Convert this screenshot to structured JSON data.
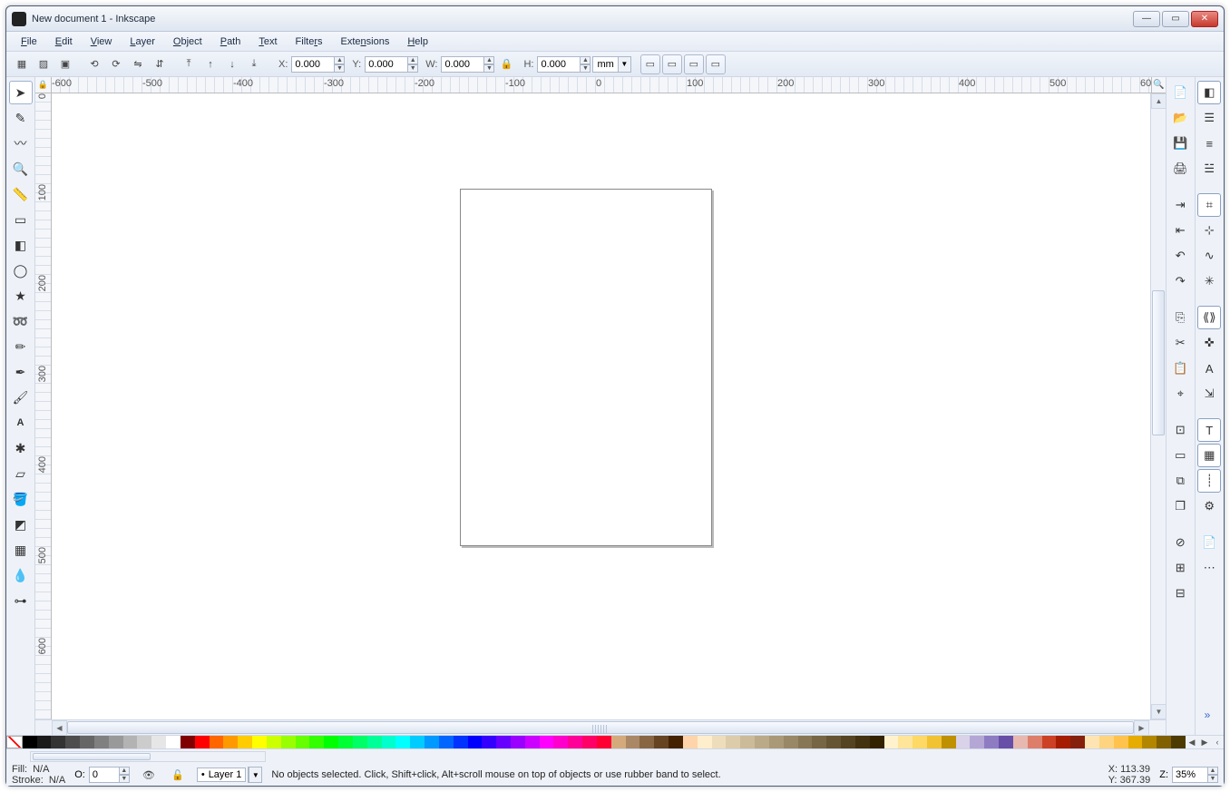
{
  "window": {
    "title": "New document 1 - Inkscape"
  },
  "menu": [
    "File",
    "Edit",
    "View",
    "Layer",
    "Object",
    "Path",
    "Text",
    "Filters",
    "Extensions",
    "Help"
  ],
  "toolbar": {
    "x_label": "X:",
    "x": "0.000",
    "y_label": "Y:",
    "y": "0.000",
    "w_label": "W:",
    "w": "0.000",
    "h_label": "H:",
    "h": "0.000",
    "unit": "mm"
  },
  "status": {
    "fill_label": "Fill:",
    "fill_value": "N/A",
    "stroke_label": "Stroke:",
    "stroke_value": "N/A",
    "o_label": "O:",
    "o_value": "0",
    "layer": "Layer 1",
    "hint": "No objects selected. Click, Shift+click, Alt+scroll mouse on top of objects or use rubber band to select.",
    "x_label": "X:",
    "x": "113.39",
    "y_label": "Y:",
    "y": "367.39",
    "z_label": "Z:",
    "z": "35%"
  },
  "tools_left": [
    "selector",
    "node",
    "tweak",
    "zoom",
    "measure",
    "rect",
    "box3d",
    "ellipse",
    "star",
    "spiral",
    "pencil",
    "bezier",
    "calligraphy",
    "text",
    "spray",
    "eraser",
    "bucket",
    "gradient",
    "mesh",
    "dropper",
    "connector"
  ],
  "right_col_a": [
    "new",
    "open",
    "save",
    "print",
    "import",
    "export",
    "undo",
    "redo",
    "copy",
    "cut",
    "paste",
    "zoom-sel",
    "zoom-draw",
    "zoom-page",
    "duplicate",
    "clone",
    "unlink",
    "group",
    "ungroup"
  ],
  "right_col_b": [
    "fill-stroke",
    "obj-props",
    "align",
    "layers",
    "snap-bounds",
    "snap-nodes",
    "snap-path",
    "snap-intersect",
    "xml",
    "snap-center",
    "snap-text",
    "transform",
    "text-tool",
    "grid",
    "guide",
    "preferences",
    "doc-props",
    "more"
  ],
  "palette": [
    "none",
    "#000000",
    "#1a1a1a",
    "#333333",
    "#4d4d4d",
    "#666666",
    "#808080",
    "#999999",
    "#b3b3b3",
    "#cccccc",
    "#e6e6e6",
    "#ffffff",
    "#800000",
    "#ff0000",
    "#ff6600",
    "#ff9900",
    "#ffcc00",
    "#ffff00",
    "#ccff00",
    "#99ff00",
    "#66ff00",
    "#33ff00",
    "#00ff00",
    "#00ff33",
    "#00ff66",
    "#00ff99",
    "#00ffcc",
    "#00ffff",
    "#00ccff",
    "#0099ff",
    "#0066ff",
    "#0033ff",
    "#0000ff",
    "#3300ff",
    "#6600ff",
    "#9900ff",
    "#cc00ff",
    "#ff00ff",
    "#ff00cc",
    "#ff0099",
    "#ff0066",
    "#ff0033",
    "#d4aa7d",
    "#aa8866",
    "#886644",
    "#664422",
    "#442200",
    "#ffd4aa",
    "#ffeecc",
    "#eeddbb",
    "#ddccaa",
    "#ccbb99",
    "#bbaa88",
    "#aa9977",
    "#998866",
    "#887755",
    "#776644",
    "#665533",
    "#554422",
    "#443311",
    "#332200",
    "#fff2cc",
    "#ffe599",
    "#ffd966",
    "#f1c232",
    "#bf9000",
    "#d9d2e9",
    "#b4a7d6",
    "#8e7cc3",
    "#674ea7",
    "#e6b8af",
    "#dd7e6b",
    "#cc4125",
    "#a61c00",
    "#85200c",
    "#ffe4b3",
    "#ffd480",
    "#ffc34d",
    "#e6ac00",
    "#b38600",
    "#806000",
    "#4d3a00"
  ]
}
